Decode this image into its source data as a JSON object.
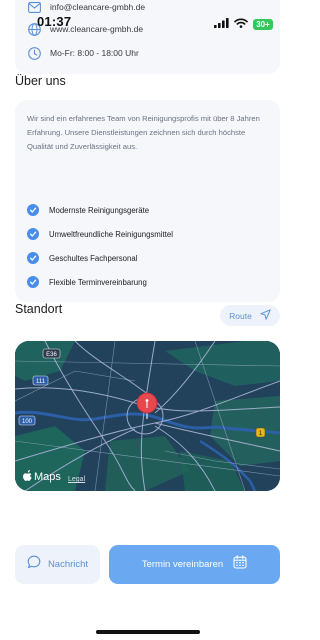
{
  "status_bar": {
    "time": "01:37",
    "battery": "30+"
  },
  "contact": {
    "email": "info@cleancare-gmbh.de",
    "website": "www.cleancare-gmbh.de",
    "hours": "Mo-Fr: 8:00 - 18:00 Uhr"
  },
  "about": {
    "title": "Über uns",
    "description": "Wir sind ein erfahrenes Team von Reinigungsprofis mit über 8 Jahren Erfahrung. Unsere Dienstleistungen zeichnen sich durch höchste Qualität und Zuverlässigkeit aus.",
    "features": [
      "Modernste Reinigungsgeräte",
      "Umweltfreundliche Reinigungsmittel",
      "Geschultes Fachpersonal",
      "Flexible Terminvereinbarung"
    ]
  },
  "location": {
    "title": "Standort",
    "route_label": "Route",
    "map_brand": "Maps",
    "map_legal": "Legal",
    "road_badges": [
      "E36",
      "111",
      "100",
      "1"
    ]
  },
  "actions": {
    "message_label": "Nachricht",
    "appointment_label": "Termin vereinbaren"
  },
  "colors": {
    "accent": "#4a8de8",
    "cta": "#6aa8f2",
    "card": "#f5f7fb",
    "check": "#4a8de8"
  }
}
